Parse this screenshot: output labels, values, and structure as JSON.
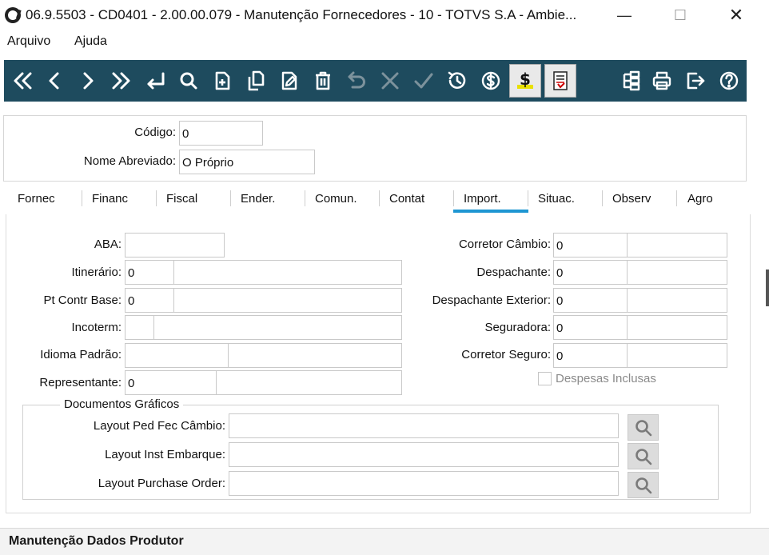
{
  "window": {
    "title": "06.9.5503 - CD0401 - 2.00.00.079 - Manutenção Fornecedores - 10 - TOTVS S.A - Ambie...",
    "minimize": "—",
    "maximize": "☐",
    "close": "✕"
  },
  "menu": {
    "items": [
      "Arquivo",
      "Ajuda"
    ]
  },
  "toolbar": {
    "bg_color": "#1e4b5e",
    "icons": [
      "first-icon",
      "previous-icon",
      "next-icon",
      "last-icon",
      "goto-icon",
      "search-icon",
      "new-icon",
      "copy-icon",
      "edit-icon",
      "delete-icon",
      "undo-icon",
      "cancel-icon",
      "confirm-icon",
      "history-icon",
      "currency-icon",
      "financial-icon",
      "report-icon",
      "tree-icon",
      "print-icon",
      "exit-icon",
      "help-icon"
    ]
  },
  "header": {
    "codigo_label": "Código:",
    "codigo_value": "0",
    "nome_label": "Nome Abreviado:",
    "nome_value": "O Próprio"
  },
  "tabs": {
    "active": "Import.",
    "accent": "#1e96d2",
    "items": [
      "Fornec",
      "Financ",
      "Fiscal",
      "Ender.",
      "Comun.",
      "Contat",
      "Import.",
      "Situac.",
      "Observ",
      "Agro"
    ]
  },
  "import_tab": {
    "left": {
      "aba_label": "ABA:",
      "aba_value": "",
      "itinerario_label": "Itinerário:",
      "itinerario_code": "0",
      "itinerario_desc": "",
      "ptcontr_label": "Pt Contr Base:",
      "ptcontr_code": "0",
      "ptcontr_desc": "",
      "incoterm_label": "Incoterm:",
      "incoterm_code": "",
      "incoterm_desc": "",
      "idioma_label": "Idioma Padrão:",
      "idioma_code": "",
      "idioma_desc": "",
      "representante_label": "Representante:",
      "representante_code": "0",
      "representante_desc": ""
    },
    "right": {
      "corretor_cambio_label": "Corretor Câmbio:",
      "corretor_cambio_code": "0",
      "despachante_label": "Despachante:",
      "despachante_code": "0",
      "desp_exterior_label": "Despachante Exterior:",
      "desp_exterior_code": "0",
      "seguradora_label": "Seguradora:",
      "seguradora_code": "0",
      "corretor_seguro_label": "Corretor Seguro:",
      "corretor_seguro_code": "0",
      "despesas_inclusas_label": "Despesas Inclusas",
      "despesas_inclusas_checked": false
    },
    "docs_group": {
      "title": "Documentos Gráficos",
      "layout_cambio_label": "Layout Ped Fec Câmbio:",
      "layout_cambio_value": "",
      "layout_embarque_label": "Layout Inst Embarque:",
      "layout_embarque_value": "",
      "layout_po_label": "Layout Purchase Order:",
      "layout_po_value": ""
    }
  },
  "status_bar": {
    "text": "Manutenção Dados Produtor"
  }
}
